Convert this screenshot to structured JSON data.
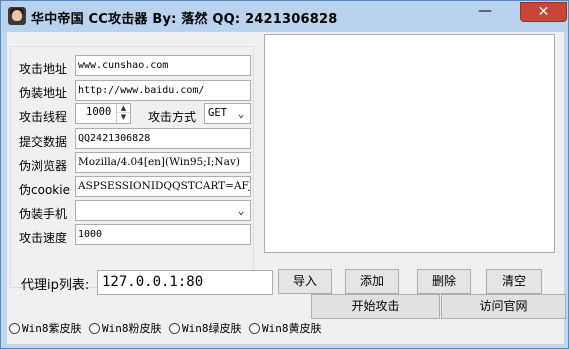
{
  "window": {
    "title": "华中帝国 CC攻击器  By:  落然  QQ:  2421306828",
    "minimize_glyph": "—",
    "close_glyph": "✕"
  },
  "form": {
    "target_label": "攻击地址",
    "target_value": "www.cunshao.com",
    "fake_label": "伪装地址",
    "fake_value": "http://www.baidu.com/",
    "threads_label": "攻击线程",
    "threads_value": "1000",
    "method_label": "攻击方式",
    "method_value": "GET",
    "postdata_label": "提交数据",
    "postdata_value": "QQ2421306828",
    "browser_label": "伪浏览器",
    "browser_value": "Mozilla/4.04[en](Win95;I;Nav)",
    "cookie_label": "伪cookie",
    "cookie_value": "ASPSESSIONIDQQSTCART=AFJFMLLE",
    "phone_label": "伪装手机",
    "phone_value": "",
    "speed_label": "攻击速度",
    "speed_value": "1000"
  },
  "proxy": {
    "label": "代理ip列表:",
    "value": "127.0.0.1:80"
  },
  "buttons": {
    "import": "导入",
    "add": "添加",
    "delete": "删除",
    "clear": "清空",
    "start": "开始攻击",
    "visit": "访问官网"
  },
  "skins": [
    "Win8紫皮肤",
    "Win8粉皮肤",
    "Win8绿皮肤",
    "Win8黄皮肤"
  ],
  "icons": {
    "spin_up": "▲",
    "spin_down": "▼",
    "dropdown": "⌄"
  }
}
